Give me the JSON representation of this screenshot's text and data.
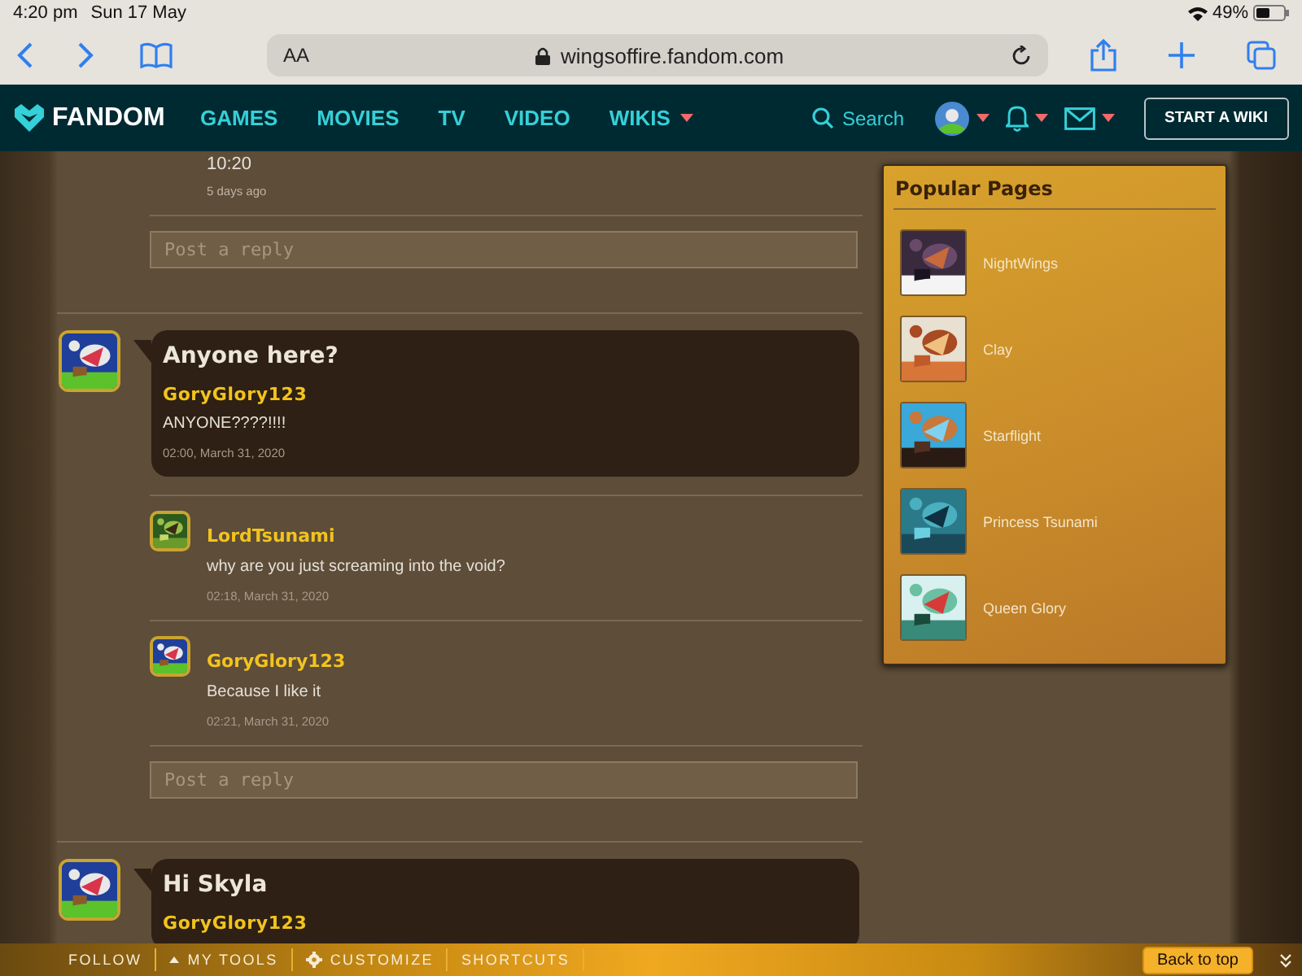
{
  "status_bar": {
    "time": "4:20 pm",
    "date": "Sun 17 May",
    "battery": "49%"
  },
  "browser": {
    "text_size": "AA",
    "url": "wingsoffire.fandom.com"
  },
  "nav": {
    "logo": "FANDOM",
    "links": [
      {
        "label": "GAMES",
        "dropdown": false
      },
      {
        "label": "MOVIES",
        "dropdown": false
      },
      {
        "label": "TV",
        "dropdown": false
      },
      {
        "label": "VIDEO",
        "dropdown": false
      },
      {
        "label": "WIKIS",
        "dropdown": true
      }
    ],
    "search": "Search",
    "start_button": "START A WIKI"
  },
  "top_reply": {
    "body": "10:20",
    "time": "5 days ago",
    "reply_field": {
      "placeholder": "Post a reply"
    }
  },
  "threads": [
    {
      "title": "Anyone here?",
      "author": "GoryGlory123",
      "body": "ANYONE????!!!!",
      "time": "02:00, March 31, 2020",
      "replies": [
        {
          "author": "LordTsunami",
          "body": "why are you just screaming into the void?",
          "time": "02:18, March 31, 2020"
        },
        {
          "author": "GoryGlory123",
          "body": "Because I like it",
          "time": "02:21, March 31, 2020"
        }
      ],
      "reply_field": {
        "placeholder": "Post a reply"
      }
    },
    {
      "title": "Hi Skyla",
      "author": "GoryGlory123"
    }
  ],
  "popular_pages": {
    "title": "Popular Pages",
    "items": [
      {
        "label": "NightWings"
      },
      {
        "label": "Clay"
      },
      {
        "label": "Starflight"
      },
      {
        "label": "Princess Tsunami"
      },
      {
        "label": "Queen Glory"
      }
    ]
  },
  "toolbar": {
    "items": [
      {
        "label": "FOLLOW",
        "kind": "plain"
      },
      {
        "label": "MY TOOLS",
        "kind": "menu"
      },
      {
        "label": "CUSTOMIZE",
        "kind": "settings"
      },
      {
        "label": "SHORTCUTS",
        "kind": "plain"
      }
    ],
    "back_to_top": "Back to top"
  }
}
